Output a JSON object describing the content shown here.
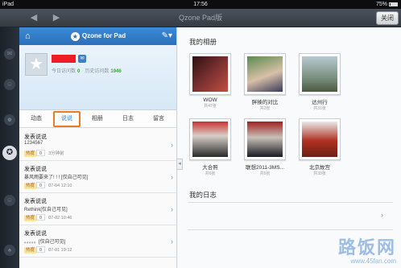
{
  "status_bar": {
    "device": "iPad",
    "time": "17:56",
    "battery_text": "75%"
  },
  "top_bar": {
    "title": "Qzone Pad版",
    "close_label": "关闭",
    "back_arrow": "◀",
    "forward_arrow": "▶"
  },
  "left_panel": {
    "brand": "Qzone for Pad",
    "home_icon": "home-icon",
    "edit_icon": "compose-icon",
    "profile": {
      "today_label": "今日访问数",
      "today_count": "0",
      "history_label": "历史访问数",
      "history_count": "1946"
    },
    "tabs": [
      "动态",
      "说说",
      "相册",
      "日志",
      "留言"
    ],
    "active_tab": 1,
    "feed": [
      {
        "title": "发表说说",
        "content": "1234567",
        "heat_label": "热度",
        "heat": "0",
        "time": "3分钟前"
      },
      {
        "title": "发表说说",
        "content": "暴风雨要来了! ! ! [仅自己可见]",
        "heat_label": "热度",
        "heat": "0",
        "time": "07-04 12:10"
      },
      {
        "title": "发表说说",
        "content": "Rethink[仅自己可见]",
        "heat_label": "热度",
        "heat": "0",
        "time": "07-02 10:46"
      },
      {
        "title": "发表说说",
        "content": "。。。。。[仅自己可见]",
        "heat_label": "热度",
        "heat": "0",
        "time": "07-01 19:12"
      }
    ]
  },
  "right_panel": {
    "albums_title": "我的相册",
    "albums": [
      {
        "name": "WOW",
        "count": "共47张",
        "color": "#5a2a2a"
      },
      {
        "name": "胖揍的对比",
        "count": "共2张",
        "color": "#3d6a3a"
      },
      {
        "name": "达州行",
        "count": "共31张",
        "color": "#8a9aa0"
      },
      {
        "name": "大合照",
        "count": "共6张",
        "color": "#a82a2a"
      },
      {
        "name": "联想2011-3MS...",
        "count": "共5张",
        "color": "#4a4a5a"
      },
      {
        "name": "北京故宫",
        "count": "共33张",
        "color": "#9a3a2a"
      }
    ],
    "blog_title": "我的日志"
  },
  "watermark": {
    "main": "路饭网",
    "sub": "www.45fan.com"
  }
}
